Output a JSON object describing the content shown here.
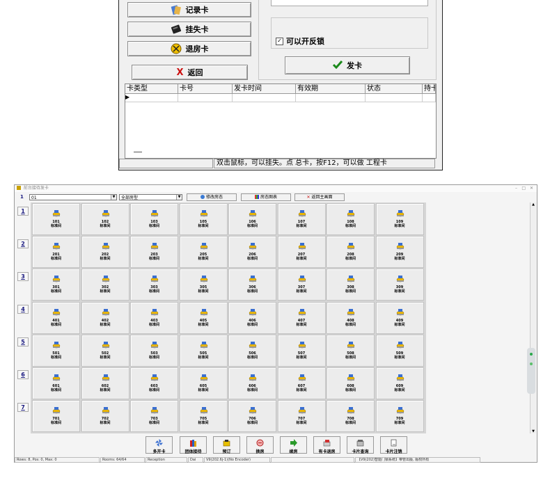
{
  "dialog": {
    "buttons": {
      "record": "记录卡",
      "report_loss": "挂失卡",
      "checkout": "退房卡",
      "back": "返回",
      "back_key": "X",
      "issue": "发卡"
    },
    "checkbox": {
      "label": "可以开反锁",
      "checked": true
    },
    "grid_columns": [
      "卡类型",
      "卡号",
      "发卡时间",
      "有效期",
      "状态",
      "持卡"
    ],
    "status_text": "双击鼠标，可以挂失。点 总卡，按F12，可以做 工程卡"
  },
  "app": {
    "title": "前台接待发卡",
    "toolbar": {
      "index": "1",
      "building_select": "01",
      "room_type_select": "全部房型",
      "edit_room": "修改房态",
      "room_report": "房态图表",
      "back_main": "返回主画面"
    },
    "floors": [
      "1",
      "2",
      "3",
      "4",
      "5",
      "6",
      "7"
    ],
    "room_type_label": "标准间",
    "room_numbers": [
      [
        "101",
        "102",
        "103",
        "105",
        "106",
        "107",
        "108",
        "109"
      ],
      [
        "201",
        "202",
        "203",
        "205",
        "206",
        "207",
        "208",
        "209"
      ],
      [
        "301",
        "302",
        "303",
        "305",
        "306",
        "307",
        "308",
        "309"
      ],
      [
        "401",
        "402",
        "403",
        "405",
        "406",
        "407",
        "408",
        "409"
      ],
      [
        "501",
        "502",
        "503",
        "505",
        "506",
        "507",
        "508",
        "509"
      ],
      [
        "601",
        "602",
        "603",
        "605",
        "606",
        "607",
        "608",
        "609"
      ],
      [
        "701",
        "702",
        "703",
        "705",
        "706",
        "707",
        "708",
        "709"
      ]
    ],
    "bottom_tools": [
      "多开卡",
      "团体接待",
      "预订",
      "换房",
      "续房",
      "有卡退房",
      "卡片查询",
      "卡片注销"
    ],
    "status": {
      "rows": "Rows: 8, Pos: 0, Max: 0",
      "rooms": "Rooms: 64/64",
      "mode": "Reception",
      "user": "Dai",
      "version": "V9(202.6j-1)(No Encoder)",
      "copyright": "【V9(202)智能门锁系统】带管出版, 版权所有"
    },
    "colors": {
      "floor_link": "#1a1a80",
      "icon_gold": "#e8b400",
      "check_green": "#1b8a1b",
      "back_red": "#cc1111"
    }
  }
}
